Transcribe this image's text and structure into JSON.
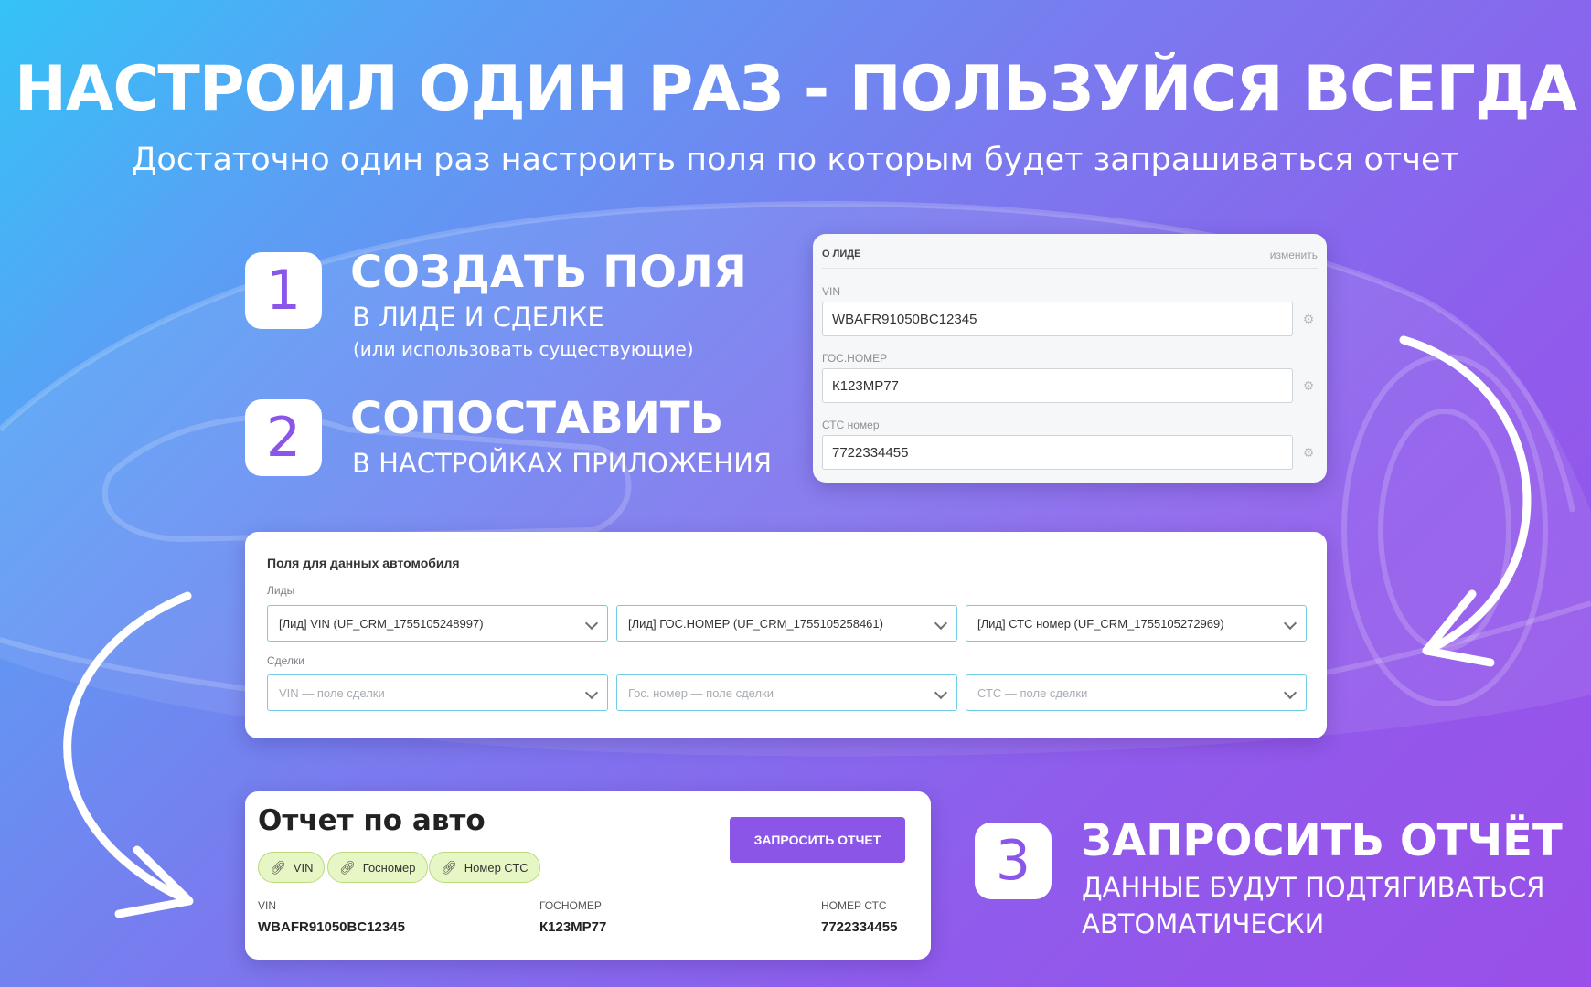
{
  "headline": "НАСТРОИЛ ОДИН РАЗ - ПОЛЬЗУЙСЯ ВСЕГДА",
  "subline": "Достаточно один раз настроить поля по которым будет запрашиваться отчет",
  "steps": [
    {
      "num": "1",
      "title": "СОЗДАТЬ ПОЛЯ",
      "sub": "В ЛИДЕ И СДЕЛКЕ",
      "note": "(или использовать существующие)"
    },
    {
      "num": "2",
      "title": "СОПОСТАВИТЬ",
      "sub": "В НАСТРОЙКАХ ПРИЛОЖЕНИЯ"
    },
    {
      "num": "3",
      "title": "ЗАПРОСИТЬ ОТЧЁТ",
      "sub1": "ДАННЫЕ БУДУТ ПОДТЯГИВАТЬСЯ",
      "sub2": "АВТОМАТИЧЕСКИ"
    }
  ],
  "lead_card": {
    "title": "О ЛИДЕ",
    "change": "изменить",
    "fields": [
      {
        "label": "VIN",
        "value": "WBAFR91050BC12345"
      },
      {
        "label": "ГОС.НОМЕР",
        "value": "К123МР77"
      },
      {
        "label": "СТС номер",
        "value": "7722334455"
      }
    ]
  },
  "settings_card": {
    "title": "Поля для данных автомобиля",
    "leads_label": "Лиды",
    "deals_label": "Сделки",
    "leads": [
      "[Лид] VIN (UF_CRM_1755105248997)",
      "[Лид] ГОС.НОМЕР (UF_CRM_1755105258461)",
      "[Лид] СТС номер (UF_CRM_1755105272969)"
    ],
    "deals": [
      "VIN — поле сделки",
      "Гос. номер — поле сделки",
      "СТС — поле сделки"
    ]
  },
  "report_card": {
    "title": "Отчет по авто",
    "button": "ЗАПРОСИТЬ ОТЧЕТ",
    "chips": [
      "VIN",
      "Госномер",
      "Номер СТС"
    ],
    "columns": [
      {
        "label": "VIN",
        "value": "WBAFR91050BC12345"
      },
      {
        "label": "ГОСНОМЕР",
        "value": "К123МР77"
      },
      {
        "label": "НОМЕР СТС",
        "value": "7722334455"
      }
    ]
  },
  "colors": {
    "accent": "#8b55e8",
    "chip_bg": "#e6f7c5",
    "select_border": "#6fcde6"
  },
  "icons": [
    "gear-icon",
    "chevron-down-icon",
    "link-icon",
    "arrow-icon"
  ]
}
